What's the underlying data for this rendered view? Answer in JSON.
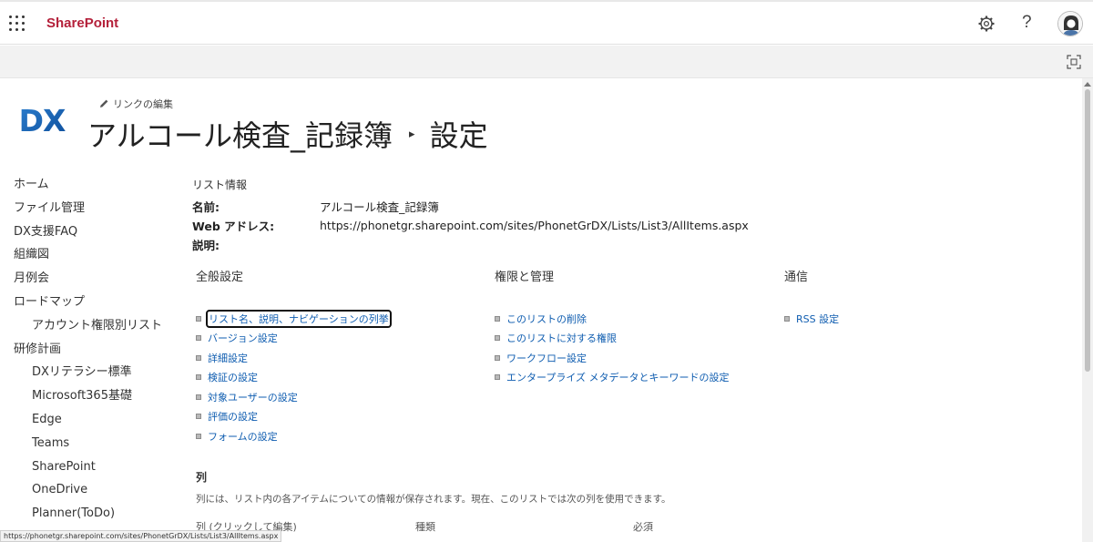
{
  "suite": {
    "brand": "SharePoint",
    "help_symbol": "?",
    "colors": {
      "brand": "#b4203a",
      "link": "#0f5db0"
    },
    "icons": [
      "app-launcher-icon",
      "gear-icon",
      "help-icon",
      "avatar-icon",
      "focus-mode-icon"
    ]
  },
  "header": {
    "logo_text": "DX",
    "edit_links": "リンクの編集",
    "list_title": "アルコール検査_記録簿",
    "separator": "▸",
    "page_name": "設定"
  },
  "nav": {
    "items": [
      {
        "label": "ホーム",
        "level": 1
      },
      {
        "label": "ファイル管理",
        "level": 1
      },
      {
        "label": "DX支援FAQ",
        "level": 1
      },
      {
        "label": "組織図",
        "level": 1
      },
      {
        "label": "月例会",
        "level": 1
      },
      {
        "label": "ロードマップ",
        "level": 1
      },
      {
        "label": "アカウント権限別リスト",
        "level": 2
      },
      {
        "label": "研修計画",
        "level": 1
      },
      {
        "label": "DXリテラシー標準",
        "level": 2
      },
      {
        "label": "Microsoft365基礎",
        "level": 2
      },
      {
        "label": "Edge",
        "level": 2
      },
      {
        "label": "Teams",
        "level": 2
      },
      {
        "label": "SharePoint",
        "level": 2
      },
      {
        "label": "OneDrive",
        "level": 2
      },
      {
        "label": "Planner(ToDo)",
        "level": 2
      }
    ]
  },
  "list_info": {
    "heading": "リスト情報",
    "name_label": "名前:",
    "name_value": "アルコール検査_記録簿",
    "web_label": "Web アドレス:",
    "web_value": "https://phonetgr.sharepoint.com/sites/PhonetGrDX/Lists/List3/AllItems.aspx",
    "desc_label": "説明:",
    "desc_value": ""
  },
  "general_settings": {
    "heading": "全般設定",
    "links": [
      "リスト名、説明、ナビゲーションの列挙",
      "バージョン設定",
      "詳細設定",
      "検証の設定",
      "対象ユーザーの設定",
      "評価の設定",
      "フォームの設定"
    ]
  },
  "permissions": {
    "heading": "権限と管理",
    "links": [
      "このリストの削除",
      "このリストに対する権限",
      "ワークフロー設定",
      "エンタープライズ メタデータとキーワードの設定"
    ]
  },
  "communications": {
    "heading": "通信",
    "links": [
      "RSS 設定"
    ]
  },
  "columns": {
    "heading": "列",
    "description": "列には、リスト内の各アイテムについての情報が保存されます。現在、このリストでは次の列を使用できます。",
    "header_name": "列 (クリックして編集)",
    "header_type": "種類",
    "header_required": "必須"
  },
  "status_url": "https://phonetgr.sharepoint.com/sites/PhonetGrDX/Lists/List3/AllItems.aspx"
}
